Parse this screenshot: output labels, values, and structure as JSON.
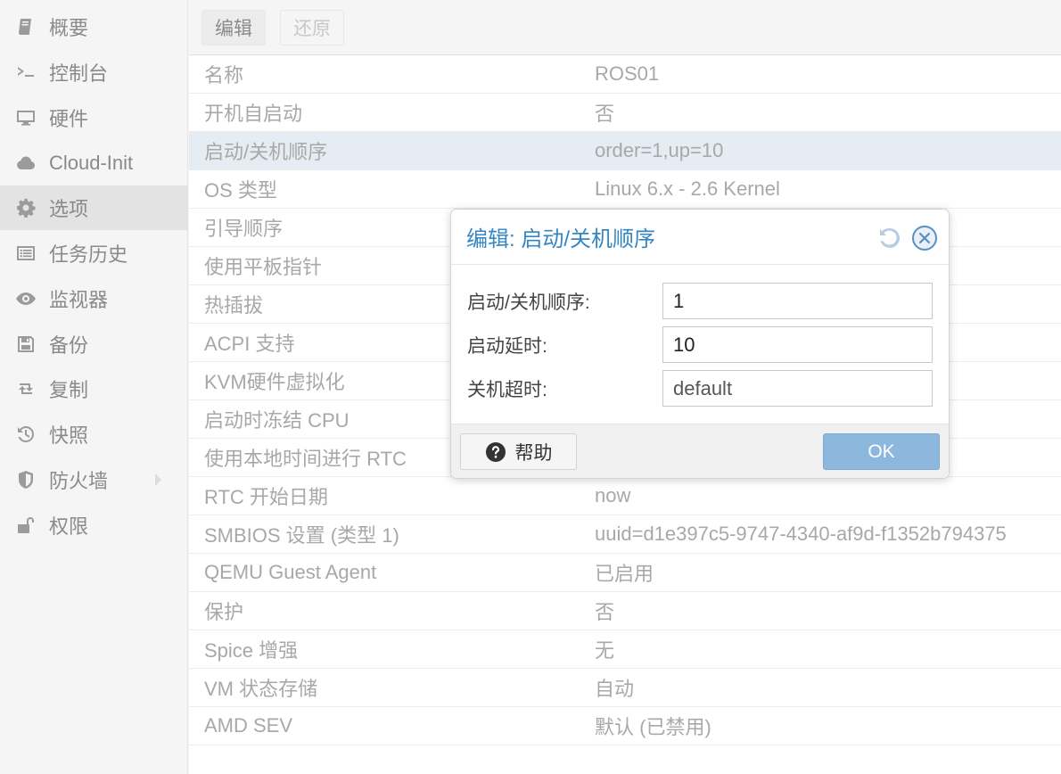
{
  "sidebar": {
    "items": [
      {
        "label": "概要",
        "icon": "book-icon"
      },
      {
        "label": "控制台",
        "icon": "terminal-icon"
      },
      {
        "label": "硬件",
        "icon": "monitor-icon"
      },
      {
        "label": "Cloud-Init",
        "icon": "cloud-icon"
      },
      {
        "label": "选项",
        "icon": "gear-icon",
        "active": true
      },
      {
        "label": "任务历史",
        "icon": "list-icon"
      },
      {
        "label": "监视器",
        "icon": "eye-icon"
      },
      {
        "label": "备份",
        "icon": "floppy-icon"
      },
      {
        "label": "复制",
        "icon": "retweet-icon"
      },
      {
        "label": "快照",
        "icon": "history-icon"
      },
      {
        "label": "防火墙",
        "icon": "shield-icon"
      },
      {
        "label": "权限",
        "icon": "unlock-icon"
      }
    ]
  },
  "toolbar": {
    "edit_label": "编辑",
    "revert_label": "还原"
  },
  "options": {
    "rows": [
      {
        "key": "名称",
        "value": "ROS01"
      },
      {
        "key": "开机自启动",
        "value": "否"
      },
      {
        "key": "启动/关机顺序",
        "value": "order=1,up=10"
      },
      {
        "key": "OS 类型",
        "value": "Linux 6.x - 2.6 Kernel"
      },
      {
        "key": "引导顺序",
        "value": ""
      },
      {
        "key": "使用平板指针",
        "value": ""
      },
      {
        "key": "热插拔",
        "value": ""
      },
      {
        "key": "ACPI 支持",
        "value": ""
      },
      {
        "key": "KVM硬件虚拟化",
        "value": ""
      },
      {
        "key": "启动时冻结 CPU",
        "value": ""
      },
      {
        "key": "使用本地时间进行 RTC",
        "value": ""
      },
      {
        "key": "RTC 开始日期",
        "value": "now"
      },
      {
        "key": "SMBIOS 设置 (类型 1)",
        "value": "uuid=d1e397c5-9747-4340-af9d-f1352b794375"
      },
      {
        "key": "QEMU Guest Agent",
        "value": "已启用"
      },
      {
        "key": "保护",
        "value": "否"
      },
      {
        "key": "Spice 增强",
        "value": "无"
      },
      {
        "key": "VM 状态存储",
        "value": "自动"
      },
      {
        "key": "AMD SEV",
        "value": "默认 (已禁用)"
      }
    ]
  },
  "dialog": {
    "title": "编辑: 启动/关机顺序",
    "fields": [
      {
        "label": "启动/关机顺序:",
        "value": "1"
      },
      {
        "label": "启动延时:",
        "value": "10"
      },
      {
        "label": "关机超时:",
        "value": "default"
      }
    ],
    "help_label": "帮助",
    "ok_label": "OK"
  },
  "colors": {
    "accent": "#3587c2",
    "ok_button": "#8db8dd",
    "selected_row": "#e6ecf3"
  }
}
